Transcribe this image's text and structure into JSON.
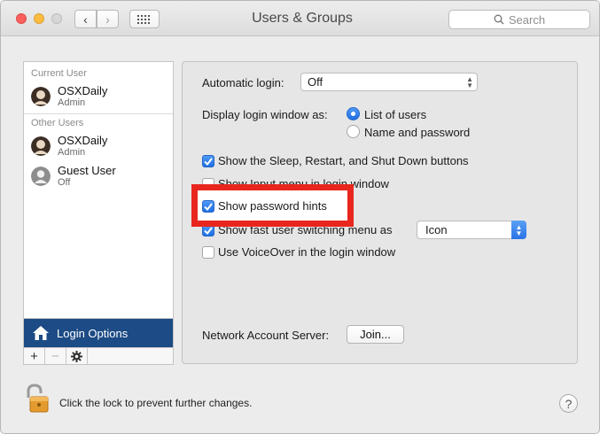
{
  "window": {
    "title": "Users & Groups",
    "search_placeholder": "Search"
  },
  "toolbar": {
    "back_glyph": "‹",
    "forward_glyph": "›"
  },
  "sidebar": {
    "current_user_header": "Current User",
    "other_users_header": "Other Users",
    "current_user": {
      "name": "OSXDaily",
      "role": "Admin",
      "icon": "user-avatar-icon"
    },
    "other_users": [
      {
        "name": "OSXDaily",
        "role": "Admin",
        "icon": "user-avatar-icon"
      },
      {
        "name": "Guest User",
        "role": "Off",
        "icon": "guest-user-icon"
      }
    ],
    "login_options_label": "Login Options",
    "actions": {
      "add": "+",
      "remove": "−",
      "settings": "gear-icon"
    }
  },
  "options": {
    "automatic_login_label": "Automatic login:",
    "automatic_login_value": "Off",
    "display_login_window_label": "Display login window as:",
    "display_modes": [
      {
        "label": "List of users",
        "selected": true
      },
      {
        "label": "Name and password",
        "selected": false
      }
    ],
    "checkboxes": [
      {
        "label": "Show the Sleep, Restart, and Shut Down buttons",
        "checked": true
      },
      {
        "label": "Show Input menu in login window",
        "checked": false
      },
      {
        "label": "Show password hints",
        "checked": true
      },
      {
        "label": "Show fast user switching menu as",
        "checked": true
      },
      {
        "label": "Use VoiceOver in the login window",
        "checked": false
      }
    ],
    "fast_user_switching_value": "Icon",
    "network_account_server_label": "Network Account Server:",
    "join_button_label": "Join..."
  },
  "footer": {
    "lock_text": "Click the lock to prevent further changes.",
    "help_label": "?"
  },
  "colors": {
    "selection_blue": "#1c4b85",
    "control_blue": "#2a72e6",
    "highlight_red": "#e8261e"
  }
}
